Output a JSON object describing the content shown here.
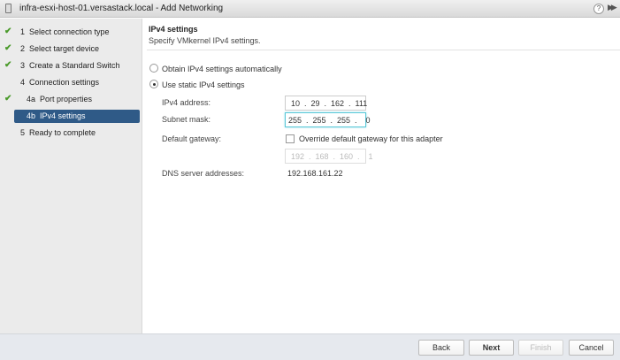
{
  "window": {
    "title": "infra-esxi-host-01.versastack.local - Add Networking",
    "help": "?",
    "expand": "▶▶"
  },
  "steps": [
    {
      "label": "1  Select connection type",
      "done": true
    },
    {
      "label": "2  Select target device",
      "done": true
    },
    {
      "label": "3  Create a Standard Switch",
      "done": true
    },
    {
      "label": "4  Connection settings",
      "done": false
    },
    {
      "label": "4a  Port properties",
      "done": true
    },
    {
      "label": "4b  IPv4 settings",
      "done": false,
      "active": true
    },
    {
      "label": "5  Ready to complete",
      "done": false
    }
  ],
  "main": {
    "title": "IPv4 settings",
    "subtitle": "Specify VMkernel IPv4 settings.",
    "radio_auto": "Obtain IPv4 settings automatically",
    "radio_static": "Use static IPv4 settings",
    "ipv4_label": "IPv4 address:",
    "ipv4_value": "10  .  29  .  162  .  111",
    "subnet_label": "Subnet mask:",
    "subnet_value": "255  .  255  .  255  .    0",
    "gateway_label": "Default gateway:",
    "gateway_override": "Override default gateway for this adapter",
    "gateway_value": "192  .  168  .  160  .    1",
    "dns_label": "DNS server addresses:",
    "dns_value": "192.168.161.22"
  },
  "footer": {
    "back": "Back",
    "next": "Next",
    "finish": "Finish",
    "cancel": "Cancel"
  }
}
